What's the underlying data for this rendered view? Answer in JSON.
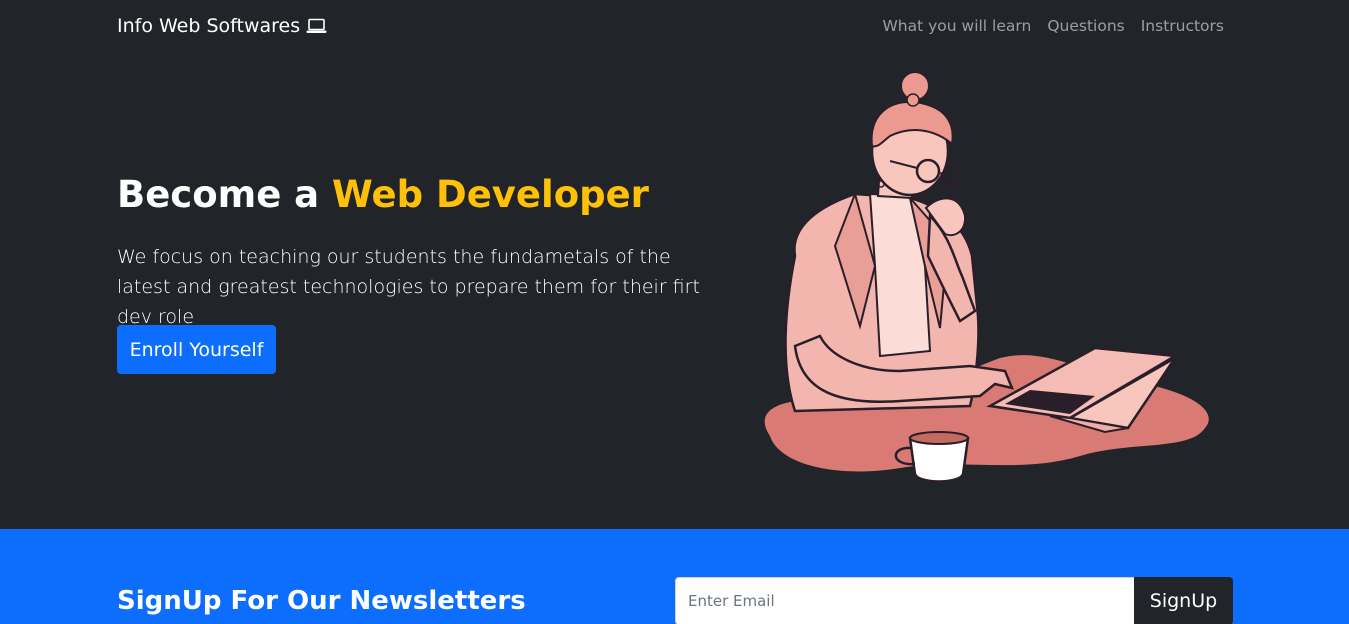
{
  "navbar": {
    "brand": "Info Web Softwares",
    "brand_icon": "laptop-icon",
    "links": [
      "What you will learn",
      "Questions",
      "Instructors"
    ]
  },
  "hero": {
    "title_prefix": "Become a ",
    "title_accent": "Web Developer",
    "lead": "We focus on teaching our students the fundametals of the latest and greatest technologies to prepare them for their firt dev role",
    "cta_label": "Enroll Yourself",
    "illustration": "woman-working-on-laptop-illustration"
  },
  "newsletter": {
    "title": "SignUp For Our Newsletters",
    "email_placeholder": "Enter Email",
    "email_value": "",
    "button_label": "SignUp"
  },
  "colors": {
    "background_dark": "#212529",
    "accent_yellow": "#ffc107",
    "primary_blue": "#0d6efd",
    "illustration_pink": "#f0b4ad",
    "illustration_blob": "#d97a75"
  }
}
